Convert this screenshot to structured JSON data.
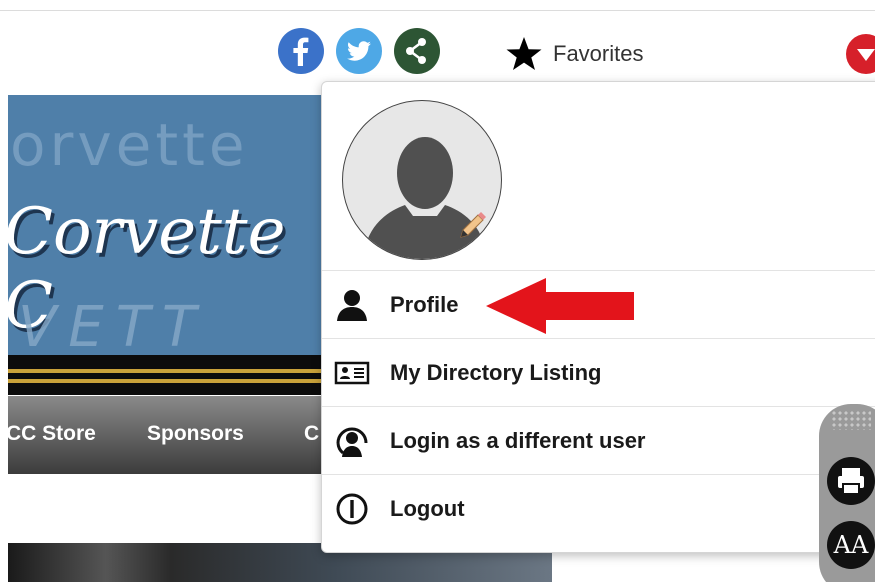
{
  "header": {
    "social": [
      "facebook-icon",
      "twitter-icon",
      "share-icon"
    ],
    "favorites_label": "Favorites"
  },
  "banner": {
    "script_text": "Corvette C",
    "ghost_top": "orvette",
    "ghost_bottom": "VETT"
  },
  "nav": {
    "items": [
      "CC Store",
      "Sponsors",
      "C"
    ]
  },
  "user_menu": {
    "items": [
      {
        "label": "Profile",
        "icon": "person-icon"
      },
      {
        "label": "My Directory Listing",
        "icon": "id-card-icon"
      },
      {
        "label": "Login as a different user",
        "icon": "switch-user-icon"
      },
      {
        "label": "Logout",
        "icon": "power-icon"
      }
    ]
  },
  "toolbar": {
    "text_size_label": "AA"
  },
  "colors": {
    "facebook": "#3b72c9",
    "twitter": "#4ea8e6",
    "share": "#2d5534",
    "annotation_arrow": "#e3141b"
  }
}
